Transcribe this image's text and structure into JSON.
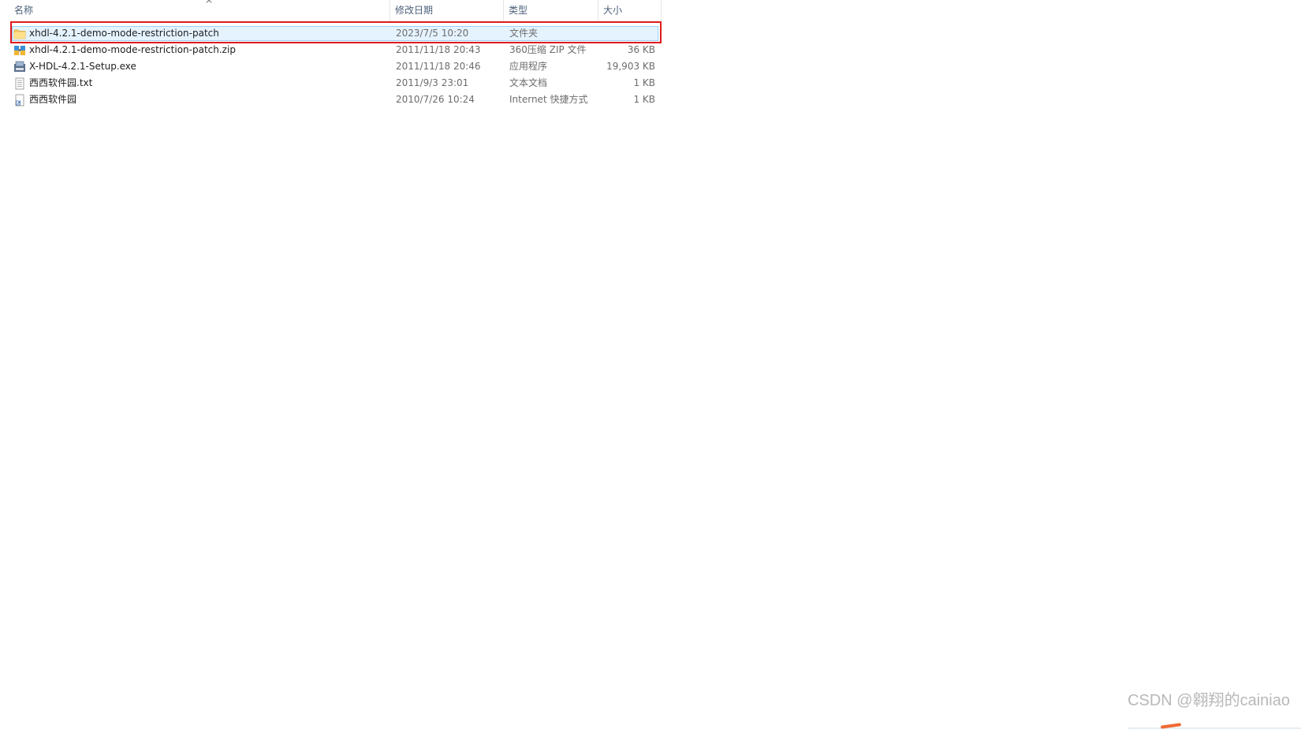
{
  "columns": {
    "name": "名称",
    "date": "修改日期",
    "type": "类型",
    "size": "大小"
  },
  "files": [
    {
      "name": "xhdl-4.2.1-demo-mode-restriction-patch",
      "date": "2023/7/5 10:20",
      "type": "文件夹",
      "size": "",
      "icon": "folder-icon",
      "selected": true
    },
    {
      "name": "xhdl-4.2.1-demo-mode-restriction-patch.zip",
      "date": "2011/11/18 20:43",
      "type": "360压缩 ZIP 文件",
      "size": "36 KB",
      "icon": "zip-archive-icon"
    },
    {
      "name": "X-HDL-4.2.1-Setup.exe",
      "date": "2011/11/18 20:46",
      "type": "应用程序",
      "size": "19,903 KB",
      "icon": "setup-exe-icon"
    },
    {
      "name": "西西软件园.txt",
      "date": "2011/9/3 23:01",
      "type": "文本文档",
      "size": "1 KB",
      "icon": "text-document-icon"
    },
    {
      "name": "西西软件园",
      "date": "2010/7/26 10:24",
      "type": "Internet 快捷方式",
      "size": "1 KB",
      "icon": "internet-shortcut-icon"
    }
  ],
  "watermark": "CSDN @翱翔的cainiao",
  "colors": {
    "selection_outline": "#e0191b",
    "selection_fill": "#e5f3ff"
  }
}
